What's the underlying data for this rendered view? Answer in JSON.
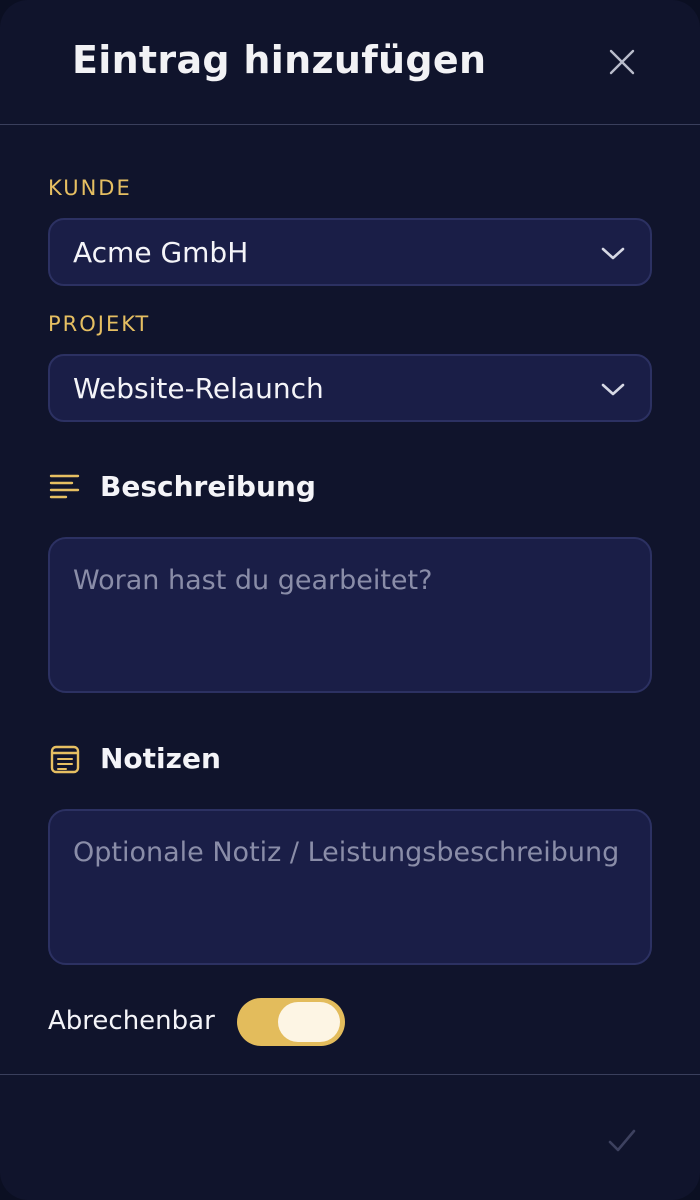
{
  "dialog": {
    "title": "Eintrag hinzufügen"
  },
  "form": {
    "customer": {
      "label": "KUNDE",
      "value": "Acme GmbH"
    },
    "project": {
      "label": "PROJEKT",
      "value": "Website-Relaunch"
    },
    "description": {
      "label": "Beschreibung",
      "placeholder": "Woran hast du gearbeitet?",
      "value": ""
    },
    "notes": {
      "label": "Notizen",
      "placeholder": "Optionale Notiz / Leistungsbeschreibung",
      "value": ""
    },
    "billable": {
      "label": "Abrechenbar",
      "on": true
    }
  },
  "icons": {
    "close": "close-icon",
    "dropdown": "chevron-down-icon",
    "description": "align-left-icon",
    "notes": "note-icon",
    "confirm": "check-icon"
  },
  "colors": {
    "accent": "#e6bf62",
    "background": "#10142c",
    "field": "#1a1e47"
  }
}
